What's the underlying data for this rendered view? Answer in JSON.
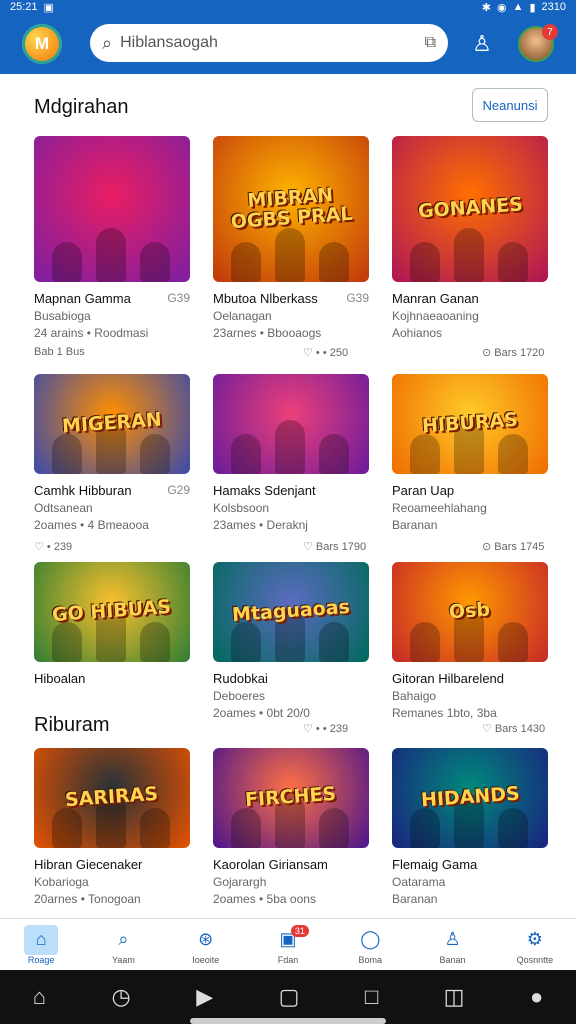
{
  "status": {
    "time": "25:21",
    "clock_right": "2310"
  },
  "header": {
    "logo_text": "M",
    "search_value": "Hiblansaogah",
    "avatar_badge": "7"
  },
  "section1": {
    "title": "Mdgirahan",
    "more_label": "Neanunsi"
  },
  "section2": {
    "title": "Riburam"
  },
  "cards": [
    {
      "title": "Mapnan Gamma",
      "code": "G39",
      "sub": "Busabioga",
      "meta": "24 arains • Roodmasi",
      "stats": "Bab 1 Bus",
      "colors": [
        "#7b1fa2",
        "#e91e63"
      ],
      "banner": ""
    },
    {
      "title": "Mbutoa Nlberkass",
      "code": "G39",
      "sub": "Oelanagan",
      "meta": "23arnes • Bbooaogs",
      "stats": "♡ • • 250",
      "colors": [
        "#bf360c",
        "#ffb300"
      ],
      "banner": "MIBRAN OGBS PRAL"
    },
    {
      "title": "Manran Ganan",
      "code": "",
      "sub": "Kojhnaeaoaning",
      "meta": "Aohianos",
      "stats": "⊙ Bars 1720",
      "colors": [
        "#ad1457",
        "#ff6f00"
      ],
      "banner": "GONANES"
    },
    {
      "title": "Camhk Hibburan",
      "code": "G29",
      "sub": "Odtsanean",
      "meta": "2oames • 4 Bmeaooa",
      "stats": "♡ • 239",
      "colors": [
        "#3949ab",
        "#ff8f00"
      ],
      "banner": "MIGERAN"
    },
    {
      "title": "Hamaks Sdenjant",
      "code": "",
      "sub": "Kolsbsoon",
      "meta": "23ames • Deraknj",
      "stats": "♡ Bars 1790",
      "colors": [
        "#6a1b9a",
        "#ec407a"
      ],
      "banner": ""
    },
    {
      "title": "Paran Uap",
      "code": "",
      "sub": "Reoameehlahang",
      "meta": "Baranan",
      "stats": "⊙ Bars 1745",
      "colors": [
        "#ef6c00",
        "#ffca28"
      ],
      "banner": "HIBURAS"
    },
    {
      "title": "Hiboalan",
      "code": "",
      "sub": "",
      "meta": "",
      "stats": "",
      "colors": [
        "#2e7d32",
        "#fbc02d"
      ],
      "banner": "GO HIBUAS"
    },
    {
      "title": "Rudobkai",
      "code": "",
      "sub": "Deboeres",
      "meta": "2oames • 0bt 20/0",
      "stats": "♡ • • 239",
      "colors": [
        "#00695c",
        "#5c6bc0"
      ],
      "banner": "Mtaguaoas"
    },
    {
      "title": "Gitoran Hilbarelend",
      "code": "",
      "sub": "Bahaigo",
      "meta": "Remanes 1bto, 3ba",
      "stats": "♡ Bars 1430",
      "colors": [
        "#c62828",
        "#ff9800"
      ],
      "banner": "Osb"
    },
    {
      "title": "Hibran Giecenaker",
      "code": "",
      "sub": "Kobarioga",
      "meta": "20arnes • Tonogoan",
      "stats": "",
      "colors": [
        "#e65100",
        "#263238"
      ],
      "banner": "SARIRAS"
    },
    {
      "title": "Kaorolan Giriansam",
      "code": "",
      "sub": "Gojarargh",
      "meta": "2oames • 5ba oons",
      "stats": "",
      "colors": [
        "#4a148c",
        "#ff7043"
      ],
      "banner": "FIRCHES"
    },
    {
      "title": "Flemaig Gama",
      "code": "",
      "sub": "Oatarama",
      "meta": "Baranan",
      "stats": "",
      "colors": [
        "#1a237e",
        "#00897b"
      ],
      "banner": "HIDANDS"
    }
  ],
  "nav": [
    {
      "label": "Roage",
      "icon": "⌂",
      "active": true,
      "badge": ""
    },
    {
      "label": "Yaam",
      "icon": "⌕",
      "active": false,
      "badge": ""
    },
    {
      "label": "Ioeoite",
      "icon": "⊛",
      "active": false,
      "badge": ""
    },
    {
      "label": "Fdan",
      "icon": "▣",
      "active": false,
      "badge": "31"
    },
    {
      "label": "Boma",
      "icon": "◯",
      "active": false,
      "badge": ""
    },
    {
      "label": "Banan",
      "icon": "♙",
      "active": false,
      "badge": ""
    },
    {
      "label": "Qosnntte",
      "icon": "⚙",
      "active": false,
      "badge": ""
    }
  ],
  "system": {
    "icons": [
      "home-icon",
      "clock-icon",
      "play-icon",
      "page-icon",
      "square-icon",
      "gallery-icon",
      "user-icon"
    ]
  }
}
